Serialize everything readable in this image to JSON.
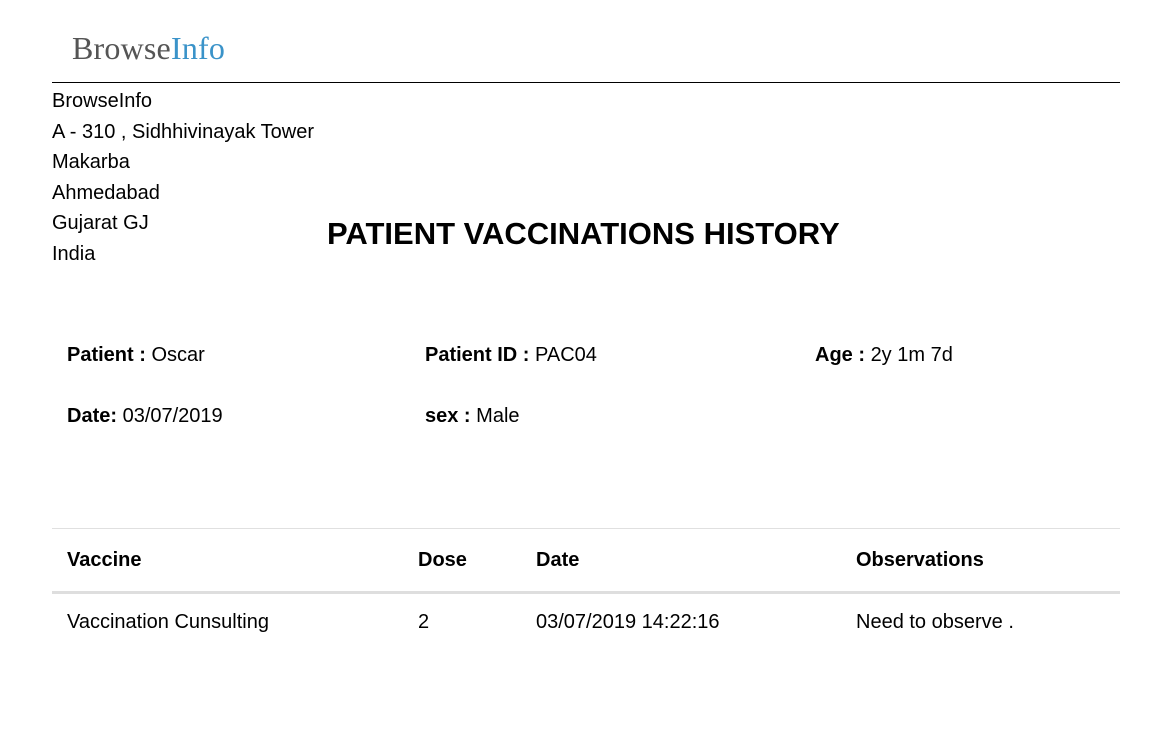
{
  "logo": {
    "part1": "Browse",
    "part2": "Info"
  },
  "company": {
    "lines": [
      "BrowseInfo",
      "A - 310 , Sidhhivinayak Tower",
      "Makarba",
      "Ahmedabad",
      "Gujarat GJ",
      "India"
    ]
  },
  "report": {
    "title": "PATIENT VACCINATIONS HISTORY"
  },
  "patient": {
    "name_label": "Patient :",
    "name": "Oscar",
    "id_label": "Patient ID :",
    "id": "PAC04",
    "age_label": "Age :",
    "age": "2y 1m 7d",
    "date_label": "Date:",
    "date": "03/07/2019",
    "sex_label": "sex :",
    "sex": "Male"
  },
  "table": {
    "headers": [
      "Vaccine",
      "Dose",
      "Date",
      "Observations"
    ],
    "rows": [
      [
        "Vaccination Cunsulting",
        "2",
        "03/07/2019 14:22:16",
        "Need to observe ."
      ]
    ]
  },
  "colors": {
    "logo_gray": "#555555",
    "logo_blue": "#3a93c9"
  }
}
